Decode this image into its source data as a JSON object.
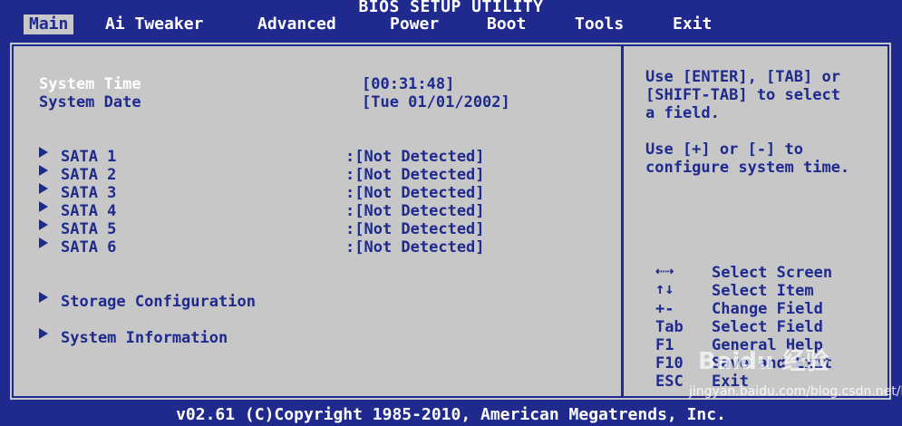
{
  "title": "BIOS SETUP UTILITY",
  "menu": [
    {
      "label": "Main",
      "active": true
    },
    {
      "label": "Ai Tweaker",
      "active": false
    },
    {
      "label": "Advanced",
      "active": false
    },
    {
      "label": "Power",
      "active": false
    },
    {
      "label": "Boot",
      "active": false
    },
    {
      "label": "Tools",
      "active": false
    },
    {
      "label": "Exit",
      "active": false
    }
  ],
  "main": {
    "system_time_label": "System Time",
    "system_time_value": "[00:31:48]",
    "system_date_label": "System Date",
    "system_date_value": "[Tue 01/01/2002]",
    "sata": [
      {
        "label": "SATA 1",
        "value": ":[Not Detected]"
      },
      {
        "label": "SATA 2",
        "value": ":[Not Detected]"
      },
      {
        "label": "SATA 3",
        "value": ":[Not Detected]"
      },
      {
        "label": "SATA 4",
        "value": ":[Not Detected]"
      },
      {
        "label": "SATA 5",
        "value": ":[Not Detected]"
      },
      {
        "label": "SATA 6",
        "value": ":[Not Detected]"
      }
    ],
    "storage_configuration": "Storage Configuration",
    "system_information": "System Information"
  },
  "help": {
    "line1": "Use [ENTER], [TAB] or",
    "line2": "[SHIFT-TAB] to select",
    "line3": "a field.",
    "line4": "Use [+] or [-] to",
    "line5": "configure system time."
  },
  "keys": [
    {
      "key": "",
      "icon": "left-right-arrows-icon",
      "desc": "Select Screen"
    },
    {
      "key": "",
      "icon": "up-down-arrows-icon",
      "desc": "Select Item"
    },
    {
      "key": "+-",
      "desc": "Change Field"
    },
    {
      "key": "Tab",
      "desc": "Select Field"
    },
    {
      "key": "F1",
      "desc": "General Help"
    },
    {
      "key": "F10",
      "desc": "Save and Exit"
    },
    {
      "key": "ESC",
      "desc": "Exit"
    }
  ],
  "footer": "v02.61 (C)Copyright 1985-2010, American Megatrends, Inc.",
  "watermark": {
    "logo": "Baidu 经验",
    "url": "jingyan.baidu.com/blog.csdn.net/hhxy_wlzx"
  },
  "colors": {
    "background": "#202a8e",
    "panel": "#c7c7c7",
    "text": "#1e2a8e",
    "selected": "#ffffff"
  }
}
